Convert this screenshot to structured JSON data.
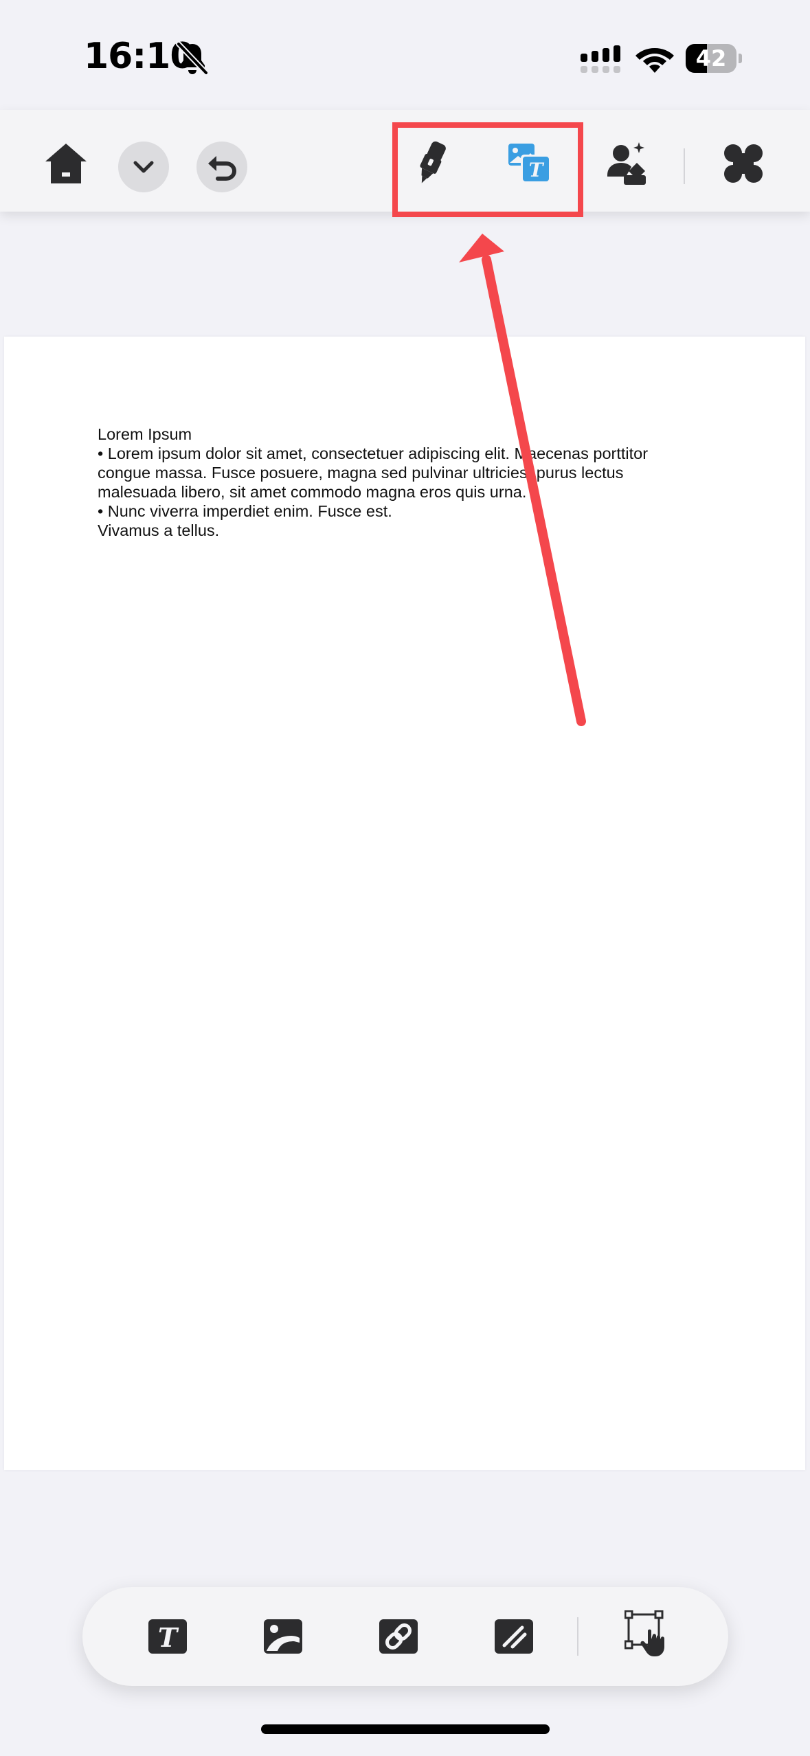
{
  "status_bar": {
    "time": "16:10",
    "battery_level": "42",
    "battery_fraction": 0.42,
    "icons": [
      "bell-slash-icon",
      "signal-icon",
      "wifi-icon",
      "battery-icon"
    ]
  },
  "toolbar": {
    "left_icons": [
      "home-icon",
      "chevron-down-icon",
      "undo-icon"
    ],
    "right_icons": [
      "highlighter-icon",
      "image-text-icon",
      "person-sparkle-icon",
      "grid-menu-icon"
    ],
    "accent_color": "#3a9ee2",
    "icon_color": "#2c2c2e"
  },
  "annotation": {
    "highlight_color": "#f4474c",
    "target": "highlighter-and-image-text-tools"
  },
  "document": {
    "lines": [
      "Lorem Ipsum",
      "• Lorem ipsum dolor sit amet, consectetuer adipiscing elit. Maecenas porttitor",
      "congue massa. Fusce posuere, magna sed pulvinar ultricies, purus lectus",
      "malesuada libero, sit amet commodo magna eros quis urna.",
      "• Nunc viverra imperdiet enim. Fusce est.",
      "Vivamus a tellus."
    ]
  },
  "dock": {
    "tools": [
      "text-tool-icon",
      "image-tool-icon",
      "link-tool-icon",
      "shape-tool-icon",
      "select-area-icon"
    ]
  }
}
